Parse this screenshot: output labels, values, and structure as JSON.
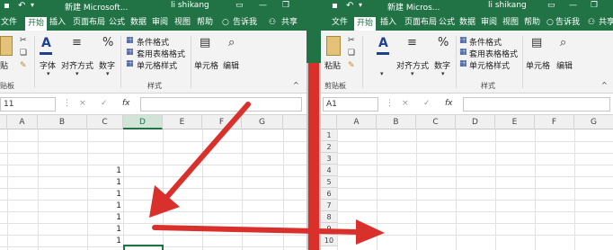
{
  "left_window": {
    "title": "新建 Microsoft...",
    "user": "li shikang",
    "tabs": [
      "文件",
      "开始",
      "插入",
      "页面布局",
      "公式",
      "数据",
      "审阅",
      "视图",
      "帮助"
    ],
    "active_tab": "开始",
    "tell_me": "告诉我",
    "share": "共享",
    "ribbon": {
      "paste": "贴",
      "clipboard_group": "贴板",
      "font": "字体",
      "alignment": "对齐方式",
      "number": "数字",
      "conditional_format": "条件格式",
      "format_as_table": "套用表格格式",
      "cell_styles": "单元格样式",
      "styles_group": "样式",
      "cells": "单元格",
      "editing": "编辑"
    },
    "name_box": "11",
    "formula_icons": [
      "×",
      "✓",
      "fx"
    ],
    "columns": [
      "A",
      "B",
      "C",
      "D",
      "E",
      "F",
      "G"
    ],
    "selected_column": "D",
    "cell_values": [
      "1",
      "1",
      "1",
      "1",
      "1",
      "1",
      "1"
    ]
  },
  "right_window": {
    "title": "新建 Micros...",
    "user": "li shikang",
    "tabs": [
      "文件",
      "开始",
      "插入",
      "页面布局",
      "公式",
      "数据",
      "审阅",
      "视图",
      "帮助"
    ],
    "active_tab": "开始",
    "tell_me": "告诉我",
    "share": "共享",
    "ribbon": {
      "paste": "粘贴",
      "clipboard_group": "剪贴板",
      "alignment": "对齐方式",
      "number": "数字",
      "conditional_format": "条件格式",
      "format_as_table": "套用表格格式",
      "cell_styles": "单元格样式",
      "styles_group": "样式",
      "cells": "单元格",
      "editing": "编辑"
    },
    "name_box": "A1",
    "formula_icons": [
      "×",
      "✓",
      "fx"
    ],
    "columns": [
      "A",
      "B",
      "C",
      "D",
      "E",
      "F",
      "G"
    ],
    "rows": [
      "1",
      "2",
      "3",
      "4",
      "5",
      "6",
      "7",
      "8",
      "9",
      "10"
    ]
  },
  "colors": {
    "excel_green": "#217346",
    "arrow_red": "#d9302c"
  },
  "icons": {
    "undo": "undo-icon",
    "cut": "cut-icon",
    "copy": "copy-icon",
    "format_painter": "format-painter-icon",
    "font_a": "font-icon",
    "percent": "percent-icon",
    "search": "search-icon",
    "share": "share-icon",
    "close": "close-icon",
    "maximize": "maximize-icon"
  }
}
